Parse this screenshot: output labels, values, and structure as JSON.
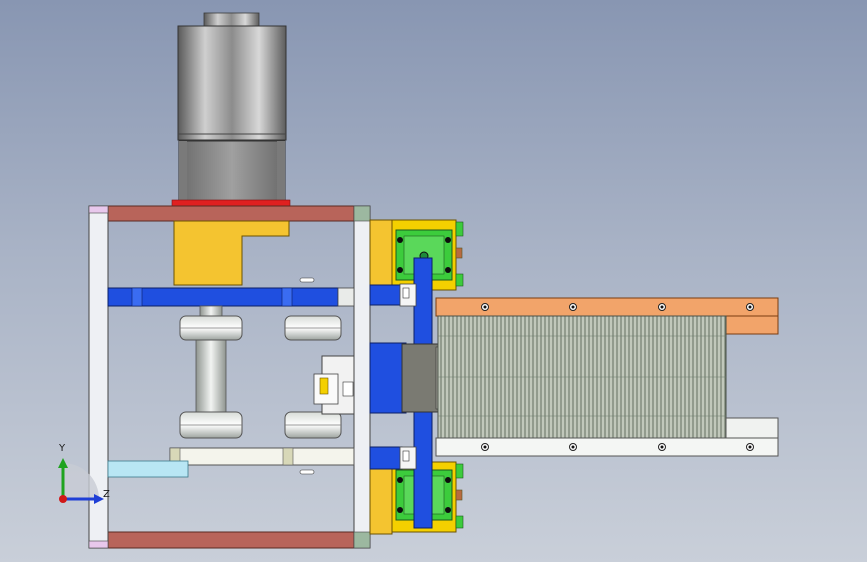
{
  "viewport": {
    "background_top": "#8896b2",
    "background_bottom": "#c9cfd9"
  },
  "triad": {
    "y_label": "Y",
    "z_label": "Z",
    "y_color": "#1fa31f",
    "z_color": "#1f3fd6",
    "x_color": "#d01818"
  },
  "colors": {
    "frame_red": "#b8645a",
    "frame_white": "#eef0f4",
    "bracket_yellow": "#f4c430",
    "slider_blue": "#1f4fe0",
    "block_green": "#3ccc3c",
    "rail_orange": "#f2a46a",
    "stack_gray": "#a8b3a0",
    "motor_steel": "#9a9a9a",
    "cyan_bar": "#b8e6f4"
  }
}
